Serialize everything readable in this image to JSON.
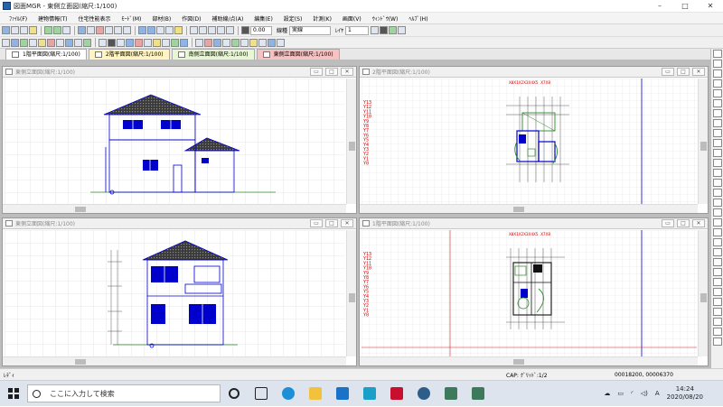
{
  "app": {
    "title": "図面MGR - 東側立面図(縮尺:1/100)",
    "window_buttons": [
      "–",
      "□",
      "✕"
    ]
  },
  "menu": [
    "ﾌｧｲﾙ(F)",
    "建物情報(T)",
    "住宅性能表示",
    "ﾓｰﾄﾞ(M)",
    "部材(B)",
    "作図(D)",
    "補助線/点(A)",
    "編集(E)",
    "設定(S)",
    "計測(K)",
    "画面(V)",
    "ｳｨﾝﾄﾞｳ(W)",
    "ﾍﾙﾌﾟ(H)"
  ],
  "toolbar": {
    "line_width_value": "0.00",
    "line_type_label": "線種",
    "line_type_value": "実線",
    "layer_label": "ﾚｲﾔ",
    "layer_value": "1"
  },
  "tabs": [
    {
      "label": "1階平面図(縮尺:1/100)"
    },
    {
      "label": "2階平面図(縮尺:1/100)"
    },
    {
      "label": "南側立面図(縮尺:1/100)"
    },
    {
      "label": "東側立面図(縮尺:1/100)"
    }
  ],
  "windows": [
    {
      "title": "東側立面図(縮尺:1/100)"
    },
    {
      "title": "2階平面図(縮尺:1/100)",
      "grid_header": "X0X1X2X3X4X5 X7X8"
    },
    {
      "title": "東側立面図(縮尺:1/100)"
    },
    {
      "title": "1階平面図(縮尺:1/100)",
      "grid_header": "X0X1X2X3X4X5 X7X8"
    }
  ],
  "grid_rows": [
    "Y13",
    "Y12",
    "Y11",
    "Y10",
    "Y9",
    "Y8",
    "Y7",
    "Y6",
    "Y5",
    "Y4",
    "Y3",
    "Y2",
    "Y1",
    "Y0"
  ],
  "status": {
    "ready": "ﾚﾃﾞｨ",
    "cap": "CAP: ｸﾞﾘｯﾄﾞ:1/2",
    "coords": "00018200, 00006370"
  },
  "taskbar": {
    "search_placeholder": "ここに入力して検索",
    "ime": "A",
    "time": "14:24",
    "date": "2020/08/20"
  },
  "colors": {
    "drawing_blue": "#0000cc",
    "roof_fill": "#3a3a3a",
    "grid_label_red": "#d40000",
    "grid_line": "#cfcfcf"
  }
}
